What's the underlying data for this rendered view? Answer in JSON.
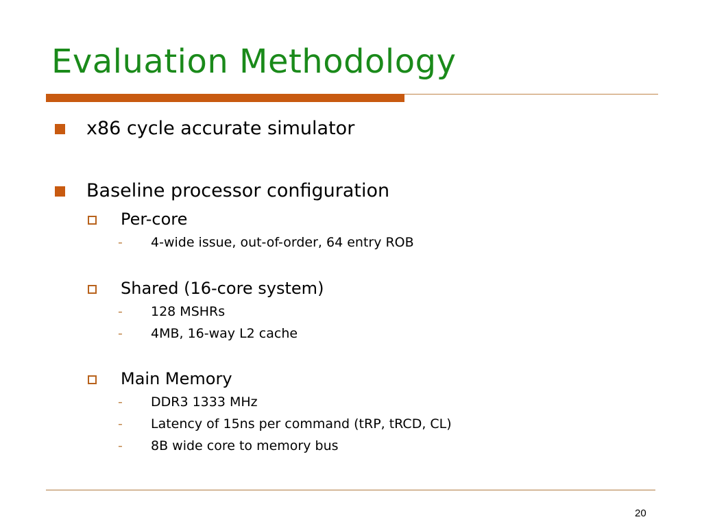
{
  "slide": {
    "title": "Evaluation Methodology",
    "page_number": "20",
    "accent_color": "#c85a10",
    "title_color": "#1a8a1a"
  },
  "bullets": [
    {
      "text": "x86 cycle accurate simulator"
    },
    {
      "text": "Baseline processor configuration",
      "children": [
        {
          "text": "Per-core",
          "items": [
            "4-wide issue, out-of-order, 64 entry ROB"
          ]
        },
        {
          "text": "Shared (16-core system)",
          "items": [
            "128 MSHRs",
            "4MB, 16-way L2 cache"
          ]
        },
        {
          "text": "Main Memory",
          "items": [
            "DDR3 1333 MHz",
            "Latency of 15ns per command (tRP, tRCD, CL)",
            "8B wide core to memory bus"
          ]
        }
      ]
    }
  ],
  "dash_glyph": "-"
}
